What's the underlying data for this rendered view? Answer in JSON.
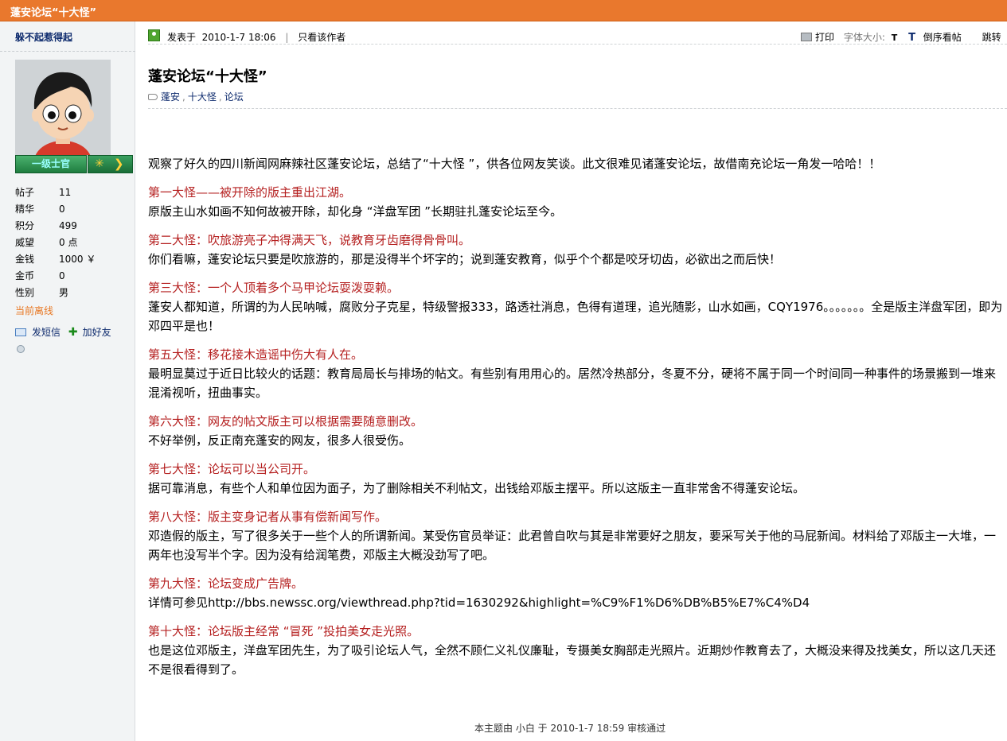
{
  "window_title": "蓬安论坛“十大怪”",
  "author": {
    "name": "躲不起惹得起",
    "rank_label": "一级士官",
    "stats": [
      {
        "label": "帖子",
        "value": "11"
      },
      {
        "label": "精华",
        "value": "0"
      },
      {
        "label": "积分",
        "value": "499"
      },
      {
        "label": "威望",
        "value": "0 点"
      },
      {
        "label": "金钱",
        "value": "1000 ￥"
      },
      {
        "label": "金币",
        "value": "0"
      },
      {
        "label": "性别",
        "value": "男"
      }
    ],
    "status": "当前离线",
    "send_message": "发短信",
    "add_friend": "加好友"
  },
  "post_header": {
    "posted_label": "发表于",
    "posted_time": "2010-1-7 18:06",
    "only_author": "只看该作者",
    "print": "打印",
    "font_size_label": "字体大小:",
    "font_small": "T",
    "font_big": "T",
    "reverse": "倒序看帖",
    "jump": "跳转"
  },
  "post": {
    "title": "蓬安论坛“十大怪”",
    "tags": [
      "蓬安",
      "十大怪",
      "论坛"
    ],
    "tag_sep": ",",
    "intro": "观察了好久的四川新闻网麻辣社区蓬安论坛，总结了“十大怪 ”，供各位网友笑谈。此文很难见诸蓬安论坛，故借南充论坛一角发一哈哈！！",
    "items": [
      {
        "heading": "第一大怪——被开除的版主重出江湖。",
        "body": "原版主山水如画不知何故被开除，却化身 “洋盘军团 ”长期驻扎蓬安论坛至今。"
      },
      {
        "heading": "第二大怪：吹旅游亮子冲得满天飞，说教育牙齿磨得骨骨叫。",
        "body": "你们看嘛，蓬安论坛只要是吹旅游的，那是没得半个坏字的；说到蓬安教育，似乎个个都是咬牙切齿，必欲出之而后快！"
      },
      {
        "heading": "第三大怪：一个人顶着多个马甲论坛耍泼耍赖。",
        "body": "蓬安人都知道，所谓的为人民呐喊，腐败分子克星，特级警报333，路透社消息，色得有道理，追光随影，山水如画，CQY1976。。。。。。。全是版主洋盘军团，即为邓四平是也！"
      },
      {
        "heading": "第五大怪：移花接木造谣中伤大有人在。",
        "body": "最明显莫过于近日比较火的话题：教育局局长与排场的帖文。有些别有用用心的。居然冷热部分，冬夏不分，硬将不属于同一个时间同一种事件的场景搬到一堆来混淆视听，扭曲事实。"
      },
      {
        "heading": "第六大怪：网友的帖文版主可以根据需要随意删改。",
        "body": "不好举例，反正南充蓬安的网友，很多人很受伤。"
      },
      {
        "heading": "第七大怪：论坛可以当公司开。",
        "body": "据可靠消息，有些个人和单位因为面子，为了删除相关不利帖文，出钱给邓版主摆平。所以这版主一直非常舍不得蓬安论坛。"
      },
      {
        "heading": "第八大怪：版主变身记者从事有偿新闻写作。",
        "body": "邓造假的版主，写了很多关于一些个人的所谓新闻。某受伤官员举证：此君曾自吹与其是非常要好之朋友，要采写关于他的马屁新闻。材料给了邓版主一大堆，一两年也没写半个字。因为没有给润笔费，邓版主大概没劲写了吧。"
      },
      {
        "heading": "第九大怪：论坛变成广告牌。",
        "body": "详情可参见http://bbs.newssc.org/viewthread.php?tid=1630292&highlight=%C9%F1%D6%DB%B5%E7%C4%D4"
      },
      {
        "heading": "第十大怪：论坛版主经常 “冒死 ”投拍美女走光照。",
        "body": "也是这位邓版主，洋盘军团先生，为了吸引论坛人气，全然不顾仁义礼仪廉耻，专摄美女胸部走光照片。近期炒作教育去了，大概没来得及找美女，所以这几天还不是很看得到了。"
      }
    ],
    "footnote": "本主题由  小白  于  2010-1-7 18:59 审核通过"
  }
}
